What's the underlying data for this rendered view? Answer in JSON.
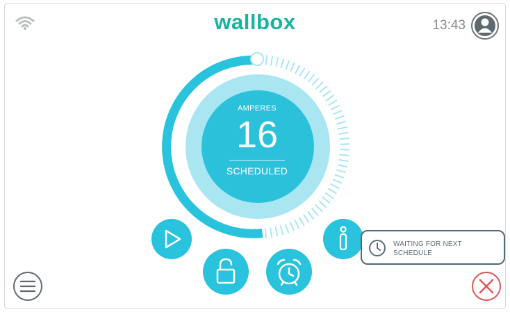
{
  "header": {
    "logo_text": "wallbox",
    "time": "13:43",
    "wifi_icon": "wifi-icon",
    "user_icon": "user-avatar-icon"
  },
  "charger": {
    "label": "AMPERES",
    "value": "16",
    "status": "SCHEDULED"
  },
  "controls": {
    "play_icon": "play-icon",
    "lock_icon": "unlock-icon",
    "schedule_icon": "alarm-clock-icon",
    "info_icon": "info-icon"
  },
  "status_message": {
    "icon": "clock-icon",
    "line1": "WAITING FOR NEXT",
    "line2": "SCHEDULE"
  },
  "footer": {
    "menu_icon": "hamburger-menu-icon",
    "close_icon": "close-icon"
  },
  "colors": {
    "brand": "#19b3a1",
    "accent": "#29c3dd",
    "accent_light": "#a9e6f2",
    "close_red": "#e0555b",
    "border_dark": "#4e6a77"
  }
}
